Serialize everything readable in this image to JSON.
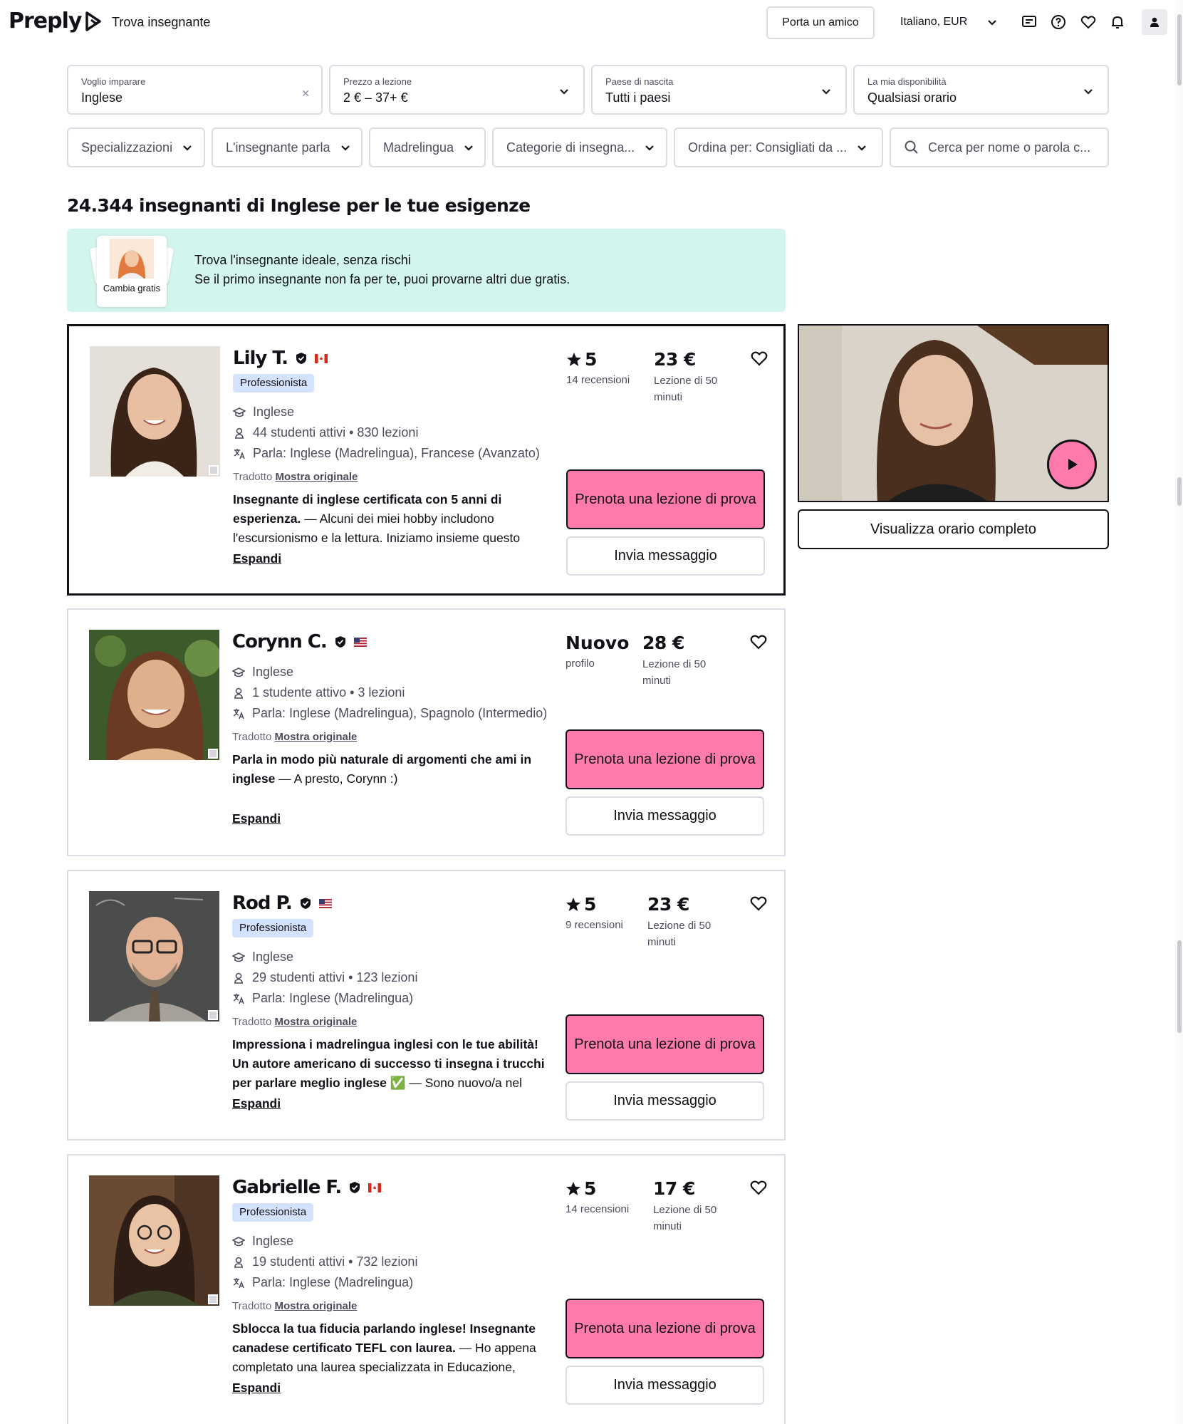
{
  "header": {
    "logo": "Preply",
    "nav_link": "Trova insegnante",
    "invite_button": "Porta un amico",
    "language_currency": "Italiano, EUR"
  },
  "filters": {
    "subject": {
      "label": "Voglio imparare",
      "value": "Inglese"
    },
    "price": {
      "label": "Prezzo a lezione",
      "value": "2 € – 37+ €"
    },
    "country": {
      "label": "Paese di nascita",
      "value": "Tutti i paesi"
    },
    "availability": {
      "label": "La mia disponibilità",
      "value": "Qualsiasi orario"
    },
    "specializations": "Specializzazioni",
    "speaks": "L'insegnante parla",
    "native": "Madrelingua",
    "categories": "Categorie di insegna...",
    "sort": "Ordina per: Consigliati da ...",
    "search_placeholder": "Cerca per nome o parola c..."
  },
  "results_title": "24.344 insegnanti di Inglese per le tue esigenze",
  "banner": {
    "card_text": "Cambia gratis",
    "title": "Trova l'insegnante ideale, senza rischi",
    "subtitle": "Se il primo insegnante non fa per te, puoi provarne altri due gratis."
  },
  "tutors": [
    {
      "name": "Lily T.",
      "flag": "canada",
      "badge": "Professionista",
      "subject": "Inglese",
      "students": "44 studenti attivi • 830 lezioni",
      "languages": "Parla: Inglese (Madrelingua), Francese (Avanzato)",
      "translated": "Tradotto",
      "show_original": "Mostra originale",
      "desc_bold": "Insegnante di inglese certificata con 5 anni di esperienza.",
      "desc_rest": " — Alcuni dei miei hobby includono l'escursionismo e la lettura. Iniziamo insieme questo",
      "expand": "Espandi",
      "rating": "5",
      "reviews": "14 recensioni",
      "price": "23 €",
      "price_unit": "Lezione di 50 minuti",
      "book": "Prenota una lezione di prova",
      "message": "Invia messaggio"
    },
    {
      "name": "Corynn C.",
      "flag": "usa",
      "badge": "",
      "subject": "Inglese",
      "students": "1 studente attivo • 3 lezioni",
      "languages": "Parla: Inglese (Madrelingua), Spagnolo (Intermedio)",
      "translated": "Tradotto",
      "show_original": "Mostra originale",
      "desc_bold": "Parla in modo più naturale di argomenti che ami in inglese",
      "desc_rest": " — A presto, Corynn :)",
      "expand": "Espandi",
      "rating": "Nuovo",
      "reviews": "profilo",
      "price": "28 €",
      "price_unit": "Lezione di 50 minuti",
      "book": "Prenota una lezione di prova",
      "message": "Invia messaggio"
    },
    {
      "name": "Rod P.",
      "flag": "usa",
      "badge": "Professionista",
      "subject": "Inglese",
      "students": "29 studenti attivi • 123 lezioni",
      "languages": "Parla: Inglese (Madrelingua)",
      "translated": "Tradotto",
      "show_original": "Mostra originale",
      "desc_bold": "Impressiona i madrelingua inglesi con le tue abilità! Un autore americano di successo ti insegna i trucchi per parlare meglio inglese ✅",
      "desc_rest": " — Sono nuovo/a nel tutoring",
      "expand": "Espandi",
      "rating": "5",
      "reviews": "9 recensioni",
      "price": "23 €",
      "price_unit": "Lezione di 50 minuti",
      "book": "Prenota una lezione di prova",
      "message": "Invia messaggio"
    },
    {
      "name": "Gabrielle F.",
      "flag": "canada",
      "badge": "Professionista",
      "subject": "Inglese",
      "students": "19 studenti attivi • 732 lezioni",
      "languages": "Parla: Inglese (Madrelingua)",
      "translated": "Tradotto",
      "show_original": "Mostra originale",
      "desc_bold": "Sblocca la tua fiducia parlando inglese! Insegnante canadese certificato TEFL con laurea.",
      "desc_rest": " — Ho appena completato una laurea specializzata in Educazione,",
      "expand": "Espandi",
      "rating": "5",
      "reviews": "14 recensioni",
      "price": "17 €",
      "price_unit": "Lezione di 50 minuti",
      "book": "Prenota una lezione di prova",
      "message": "Invia messaggio"
    }
  ],
  "schedule_button": "Visualizza orario completo",
  "colors": {
    "accent": "#ff7aac",
    "banner": "#d2f6ee",
    "badge": "#d3e3ff",
    "border": "#dcdce5",
    "text": "#121117"
  }
}
